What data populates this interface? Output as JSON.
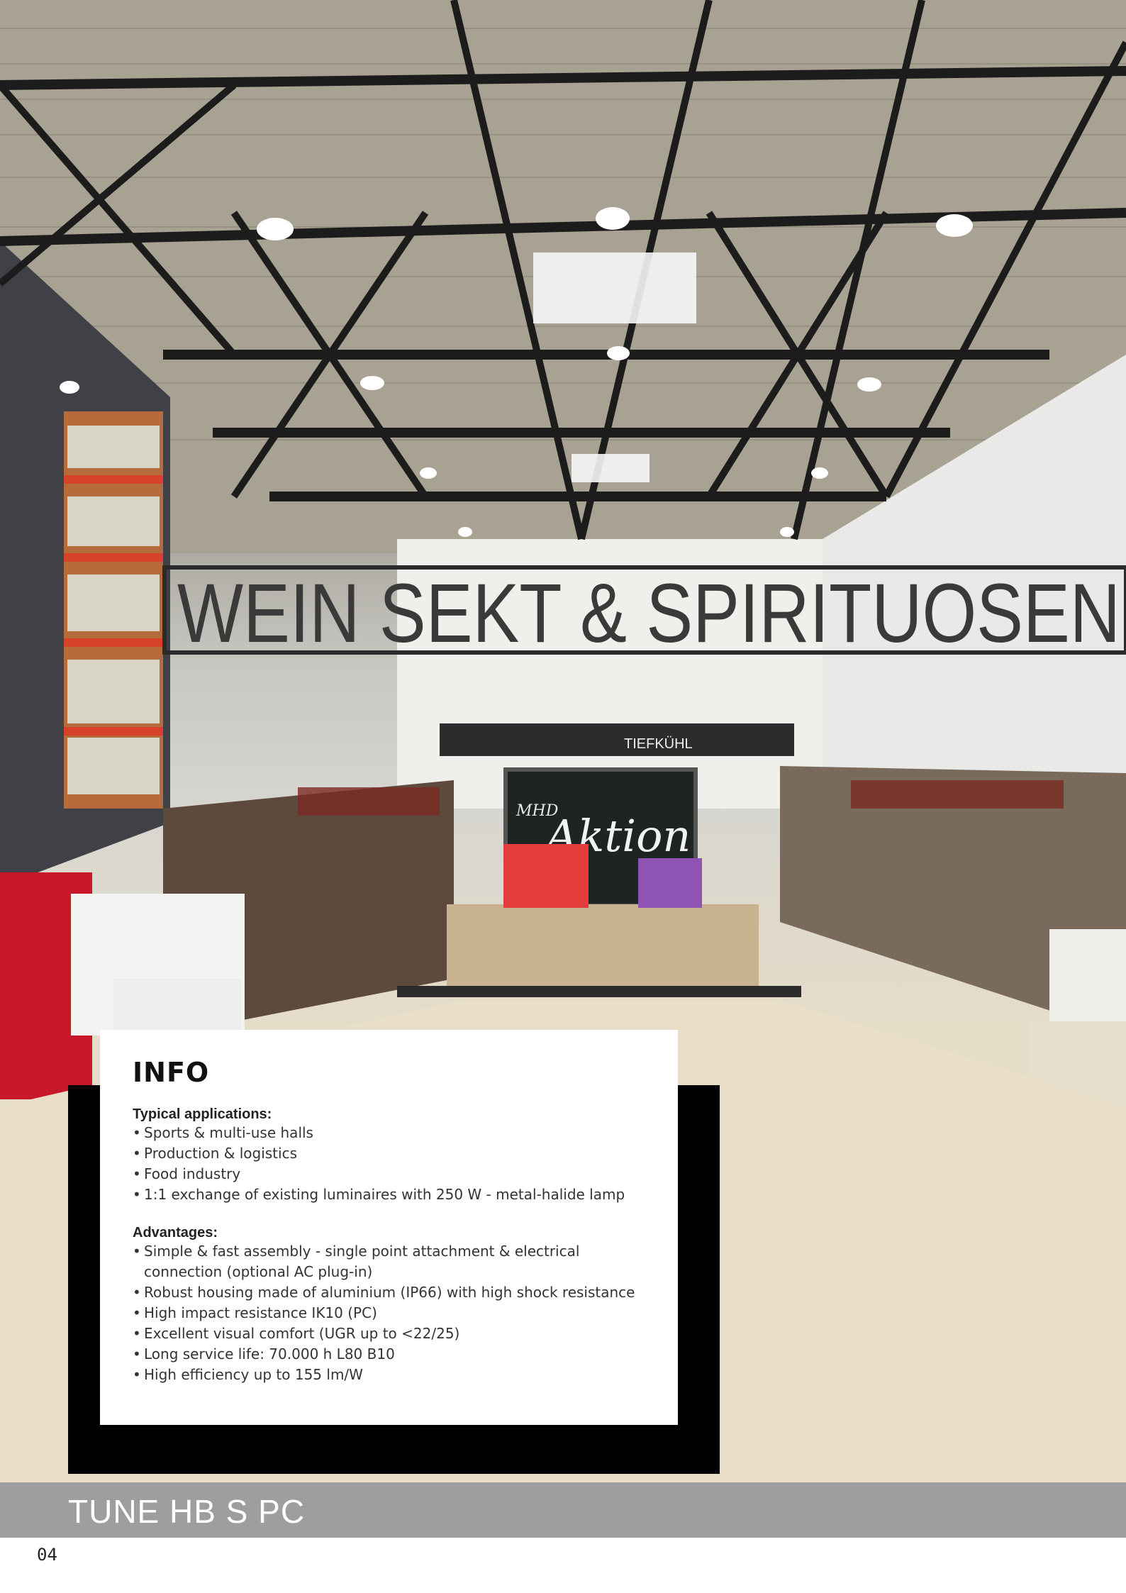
{
  "info": {
    "heading": "INFO",
    "applications_title": "Typical applications:",
    "applications": [
      "Sports & multi-use halls",
      "Production & logistics",
      "Food industry",
      "1:1 exchange of existing luminaires with 250 W - metal-halide lamp"
    ],
    "advantages_title": "Advantages:",
    "advantages": [
      "Simple & fast assembly - single point attachment  & electrical connection (optional AC plug-in)",
      "Robust housing made of aluminium (IP66) with high shock resistance",
      "High impact resistance IK10 (PC)",
      "Excellent visual comfort (UGR up to <22/25)",
      "Long service life: 70.000 h L80 B10",
      "High efficiency up to 155 lm/W"
    ]
  },
  "photo": {
    "sign_text": "WEIN SEKT & SPIRITUOSEN",
    "board_text": "Aktion",
    "board_small": "MHD",
    "tiefkuhl_text": "TIEFKÜHL"
  },
  "footer": {
    "model": "TUNE HB S PC",
    "page_number": "04"
  }
}
